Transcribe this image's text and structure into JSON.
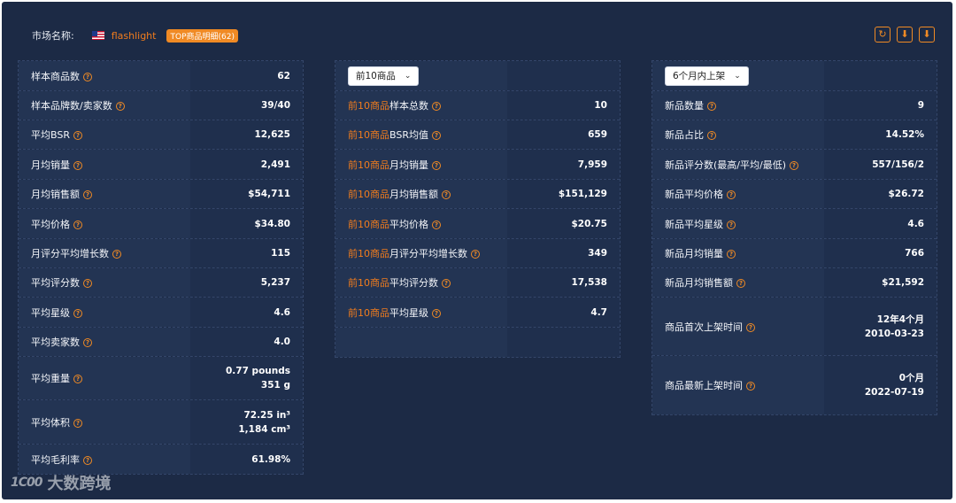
{
  "header": {
    "label": "市场名称:",
    "market": "flashlight",
    "badge": "TOP商品明细(62)"
  },
  "toolbar": {
    "refresh_icon": "↻",
    "download1_icon": "⬇",
    "download2_icon": "⬇"
  },
  "left": {
    "rows": [
      {
        "label": "样本商品数",
        "value": "62"
      },
      {
        "label": "样本品牌数/卖家数",
        "value": "39/40"
      },
      {
        "label": "平均BSR",
        "value": "12,625"
      },
      {
        "label": "月均销量",
        "value": "2,491"
      },
      {
        "label": "月均销售额",
        "value": "$54,711"
      },
      {
        "label": "平均价格",
        "value": "$34.80"
      },
      {
        "label": "月评分平均增长数",
        "value": "115"
      },
      {
        "label": "平均评分数",
        "value": "5,237"
      },
      {
        "label": "平均星级",
        "value": "4.6"
      },
      {
        "label": "平均卖家数",
        "value": "4.0"
      },
      {
        "label": "平均重量",
        "value": "0.77 pounds",
        "value2": "351 g"
      },
      {
        "label": "平均体积",
        "value": "72.25 in³",
        "value2": "1,184 cm³"
      },
      {
        "label": "平均毛利率",
        "value": "61.98%"
      }
    ]
  },
  "middle": {
    "select": "前10商品",
    "prefix": "前10商品",
    "rows": [
      {
        "label": "样本总数",
        "value": "10"
      },
      {
        "label": "BSR均值",
        "value": "659"
      },
      {
        "label": "月均销量",
        "value": "7,959"
      },
      {
        "label": "月均销售额",
        "value": "$151,129"
      },
      {
        "label": "平均价格",
        "value": "$20.75"
      },
      {
        "label": "月评分平均增长数",
        "value": "349"
      },
      {
        "label": "平均评分数",
        "value": "17,538"
      },
      {
        "label": "平均星级",
        "value": "4.7"
      }
    ]
  },
  "right": {
    "select": "6个月内上架",
    "rows": [
      {
        "label": "新品数量",
        "value": "9"
      },
      {
        "label": "新品占比",
        "value": "14.52%"
      },
      {
        "label": "新品评分数(最高/平均/最低)",
        "value": "557/156/2"
      },
      {
        "label": "新品平均价格",
        "value": "$26.72"
      },
      {
        "label": "新品平均星级",
        "value": "4.6"
      },
      {
        "label": "新品月均销量",
        "value": "766"
      },
      {
        "label": "新品月均销售额",
        "value": "$21,592"
      },
      {
        "label": "商品首次上架时间",
        "value": "12年4个月",
        "value2": "2010-03-23"
      },
      {
        "label": "商品最新上架时间",
        "value": "0个月",
        "value2": "2022-07-19"
      }
    ]
  },
  "watermark": {
    "logo": "1C00",
    "text": "大数跨境"
  },
  "colors": {
    "background": "#1c2a45",
    "accent": "#f07c1d"
  }
}
